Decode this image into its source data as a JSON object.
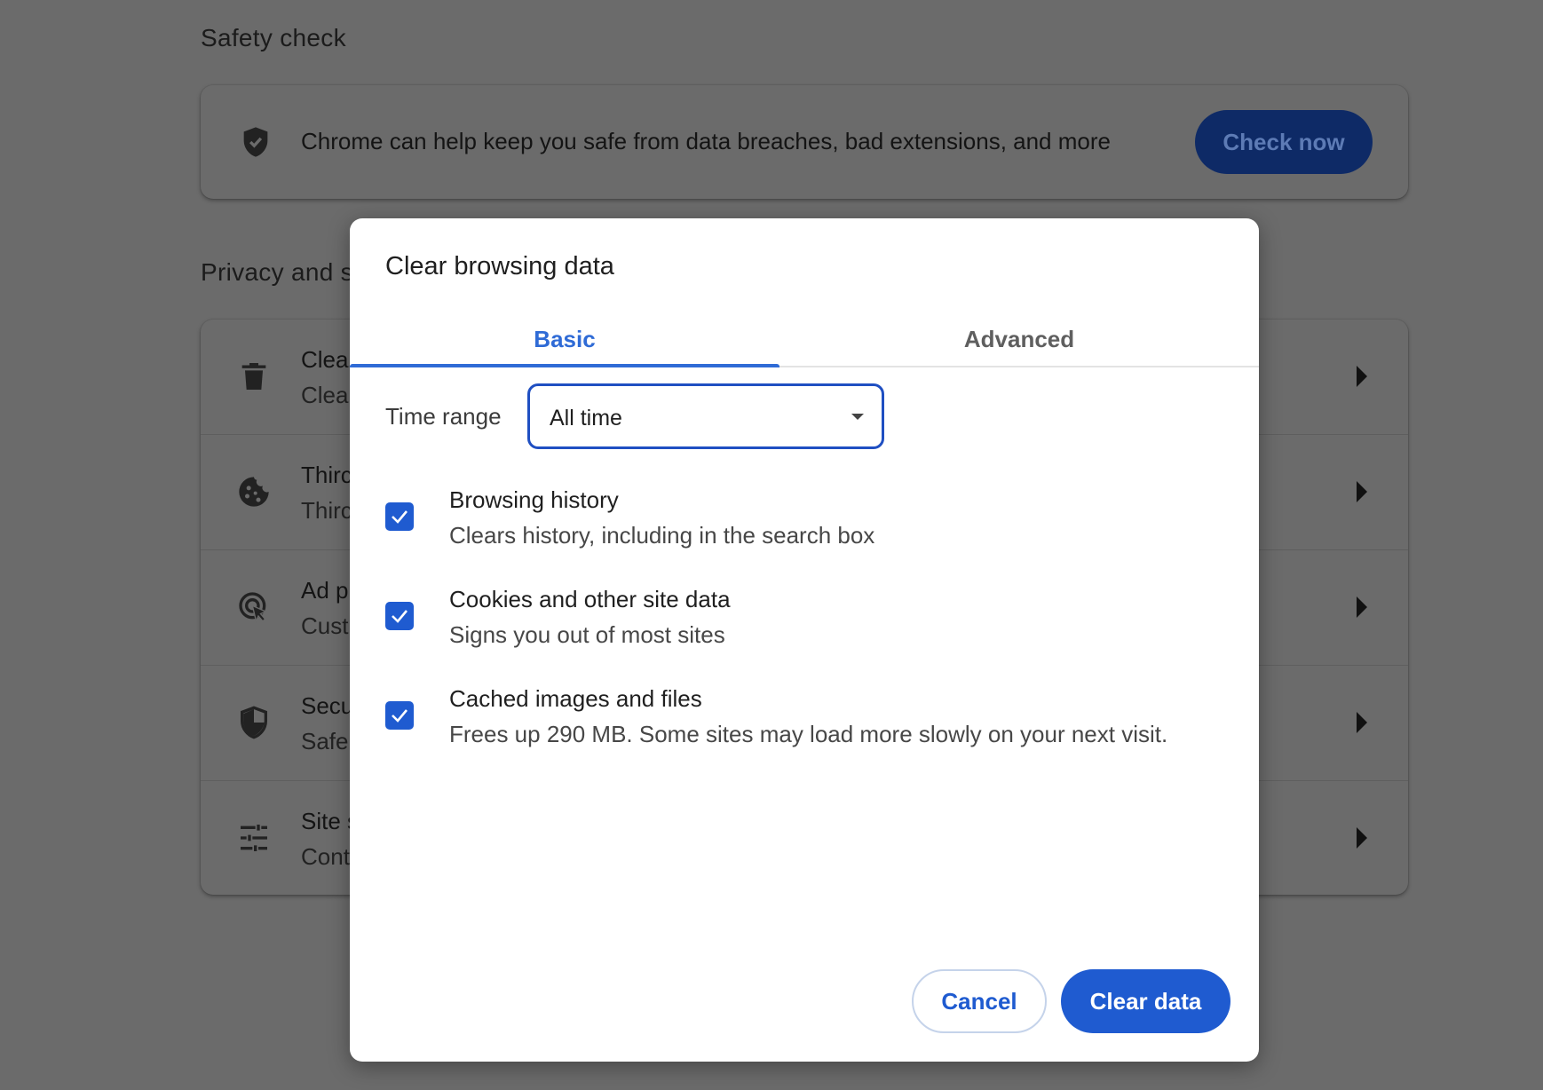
{
  "background": {
    "safety_check": {
      "heading": "Safety check",
      "description": "Chrome can help keep you safe from data breaches, bad extensions, and more",
      "button_label": "Check now"
    },
    "privacy": {
      "heading": "Privacy and s",
      "rows": [
        {
          "icon": "trash-icon",
          "title": "Clea",
          "subtitle": "Clea"
        },
        {
          "icon": "cookie-icon",
          "title": "Thirc",
          "subtitle": "Thirc"
        },
        {
          "icon": "ad-privacy-icon",
          "title": "Ad p",
          "subtitle": "Cust"
        },
        {
          "icon": "security-shield-icon",
          "title": "Secu",
          "subtitle": "Safe"
        },
        {
          "icon": "tune-icon",
          "title": "Site s",
          "subtitle": "Cont"
        }
      ]
    }
  },
  "dialog": {
    "title": "Clear browsing data",
    "tabs": [
      {
        "label": "Basic",
        "selected": true
      },
      {
        "label": "Advanced",
        "selected": false
      }
    ],
    "time_range": {
      "label": "Time range",
      "value": "All time"
    },
    "options": [
      {
        "title": "Browsing history",
        "subtitle": "Clears history, including in the search box",
        "checked": true
      },
      {
        "title": "Cookies and other site data",
        "subtitle": "Signs you out of most sites",
        "checked": true
      },
      {
        "title": "Cached images and files",
        "subtitle": "Frees up 290 MB. Some sites may load more slowly on your next visit.",
        "checked": true
      }
    ],
    "cancel_label": "Cancel",
    "confirm_label": "Clear data"
  },
  "colors": {
    "accent": "#1f5bd0",
    "overlay": "#6b6b6b",
    "tab_active": "#2f6bd6"
  }
}
